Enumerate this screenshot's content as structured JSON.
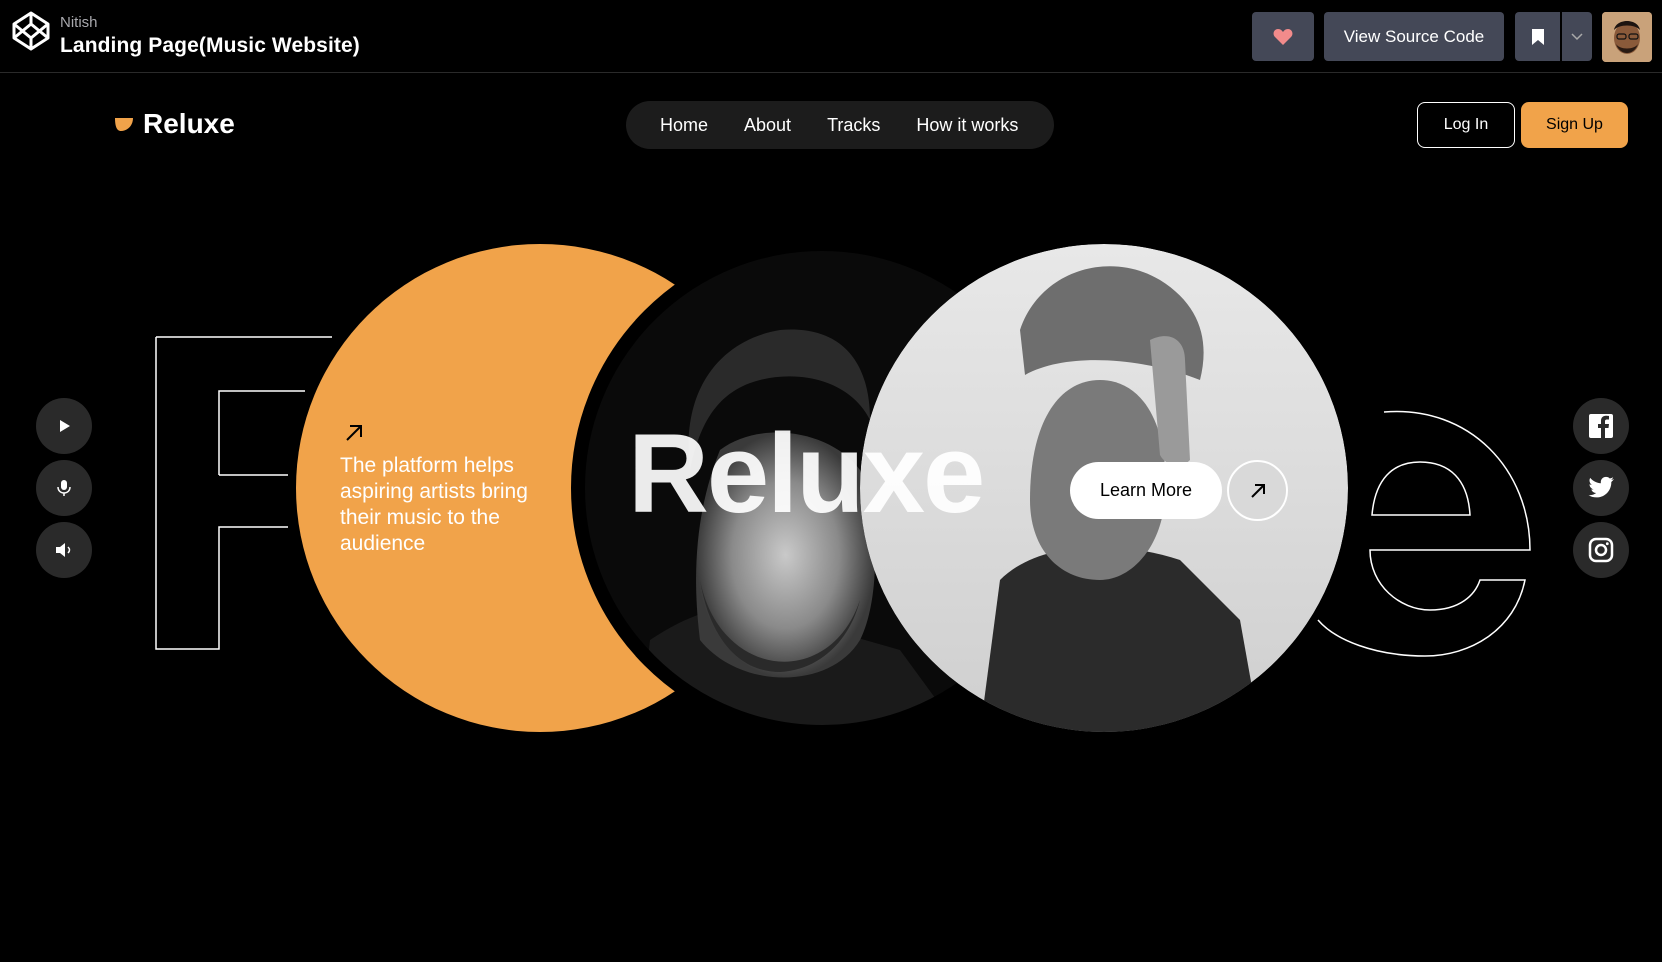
{
  "codepen": {
    "author": "Nitish",
    "pen_title": "Landing Page(Music Website)",
    "view_source_label": "View Source Code",
    "icons": [
      "codepen-logo-icon",
      "heart-icon",
      "bookmark-icon",
      "chevron-down-icon"
    ]
  },
  "site": {
    "brand": "Reluxe",
    "nav": [
      "Home",
      "About",
      "Tracks",
      "How it works"
    ],
    "login_label": "Log In",
    "signup_label": "Sign Up",
    "colors": {
      "accent": "#f1a34a",
      "background": "#000000",
      "nav_pill": "#1c1c1c"
    }
  },
  "hero": {
    "tagline": "The platform helps aspiring artists bring their music to the audience",
    "big_word": "Reluxe",
    "learn_more_label": "Learn More",
    "outline_letters": [
      "F",
      "e"
    ]
  },
  "side_controls": [
    "play-icon",
    "microphone-icon",
    "speaker-icon"
  ],
  "social": [
    "facebook-icon",
    "twitter-icon",
    "instagram-icon"
  ]
}
